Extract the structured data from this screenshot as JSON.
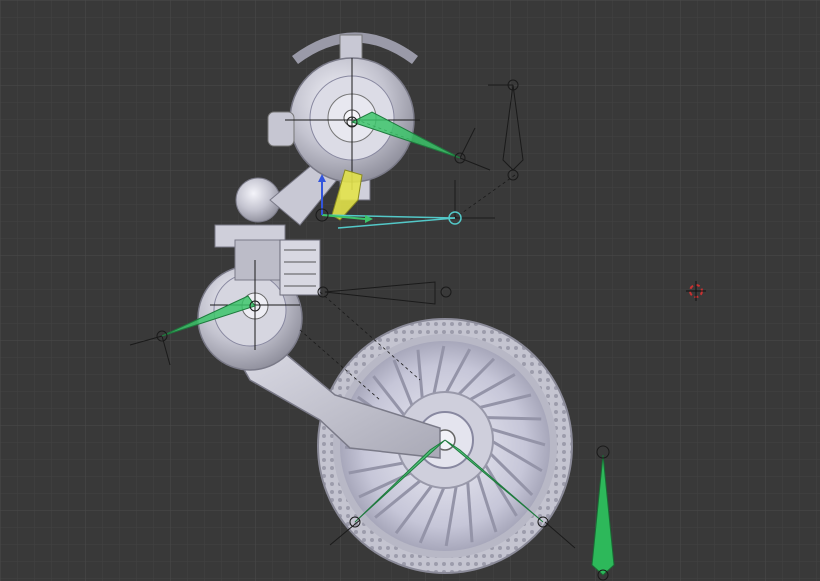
{
  "viewport": {
    "background": "#393939",
    "grid_minor": "#424242",
    "grid_major": "#4b4b4b"
  },
  "scene": {
    "objects": [
      "wheel",
      "tire",
      "swing-arm",
      "upper-hub",
      "joint-hub",
      "mounting-bracket",
      "shock-linkage",
      "wheel-axle"
    ],
    "bones_color": "#3cc46a",
    "selected_bone_color": "#e2e24a",
    "ik_line_color": "#53c8c8",
    "cursor_color": "#c83232"
  }
}
